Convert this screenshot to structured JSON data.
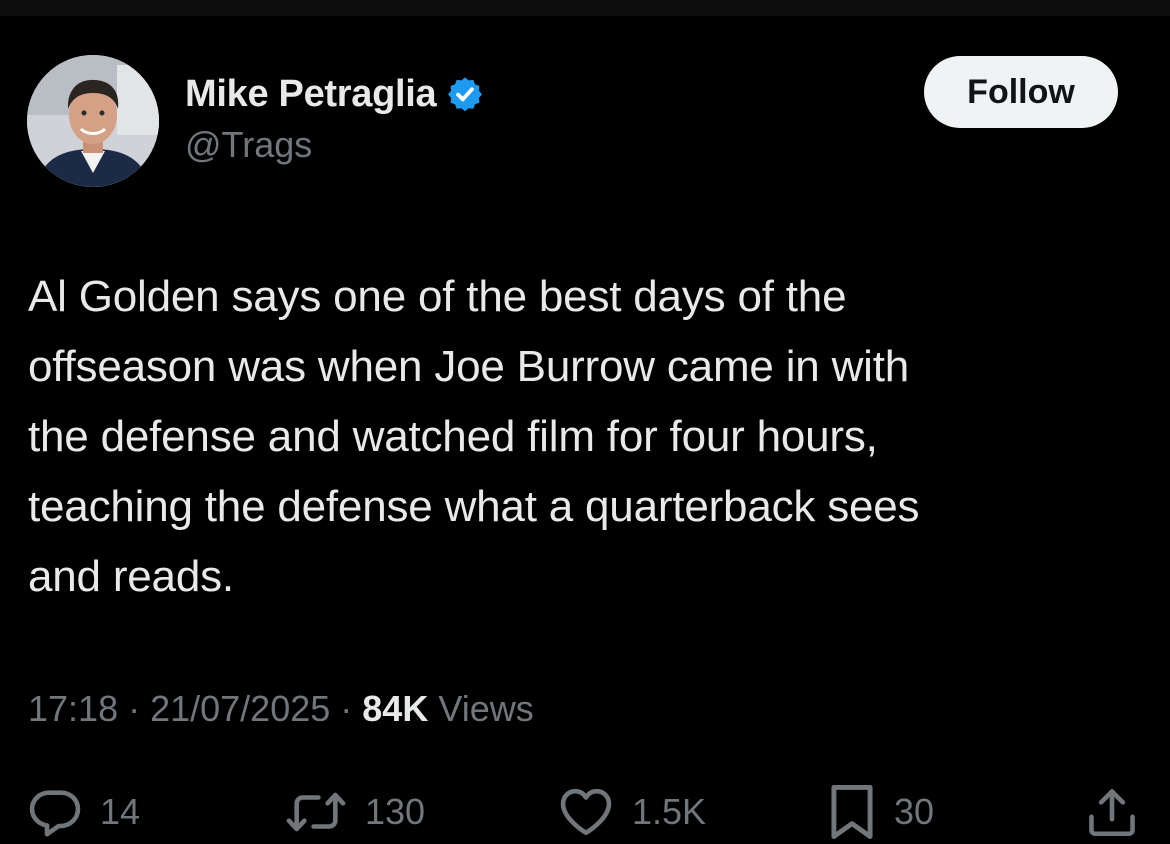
{
  "author": {
    "display_name": "Mike Petraglia",
    "handle": "@Trags",
    "verified": true
  },
  "follow_label": "Follow",
  "tweet": {
    "lines": [
      "Al Golden says one of the best days of the",
      "offseason was when Joe Burrow came in with",
      "the defense and watched film for four hours,",
      "teaching the defense what a quarterback sees",
      "and reads."
    ]
  },
  "meta": {
    "time": "17:18",
    "separator": " · ",
    "date": "21/07/2025",
    "views_count": "84K",
    "views_label": " Views"
  },
  "actions": {
    "replies": "14",
    "reposts": "130",
    "likes": "1.5K",
    "bookmarks": "30"
  },
  "colors": {
    "background": "#000000",
    "text": "#e7e9ea",
    "secondary": "#71767b",
    "verified_badge": "#1d9bf0",
    "follow_button_bg": "#eff3f4"
  },
  "icons": {
    "verified": "verified-badge-icon",
    "reply": "reply-icon",
    "repost": "repost-icon",
    "like": "heart-icon",
    "bookmark": "bookmark-icon",
    "share": "share-icon"
  }
}
